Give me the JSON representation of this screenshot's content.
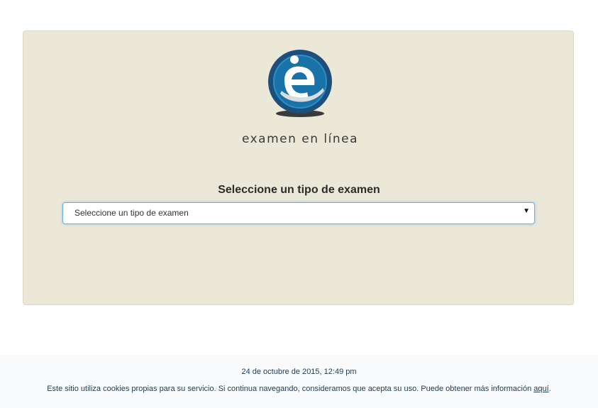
{
  "logo": {
    "icon": "examen-en-linea-logo",
    "text": "examen en línea",
    "colors": {
      "ring": "#1d4f7c",
      "inner": "#1a6fa3",
      "accent": "#ffffff"
    }
  },
  "exam_form": {
    "heading": "Seleccione un tipo de examen",
    "select": {
      "selected": "Seleccione un tipo de examen",
      "arrow_icon": "caret-down-icon"
    }
  },
  "footer": {
    "date": "24 de octubre de 2015, 12:49 pm",
    "cookie_notice": "Este sitio utiliza cookies propias para su servicio. Si continua navegando, consideramos que acepta su uso. Puede obtener más información ",
    "cookie_link": "aquí",
    "cookie_end": "."
  },
  "colors": {
    "panel_bg": "#ece8d8",
    "select_focus_border": "#66afe9",
    "footer_bg": "#f9fafb",
    "footer_text": "#1f3b55"
  }
}
